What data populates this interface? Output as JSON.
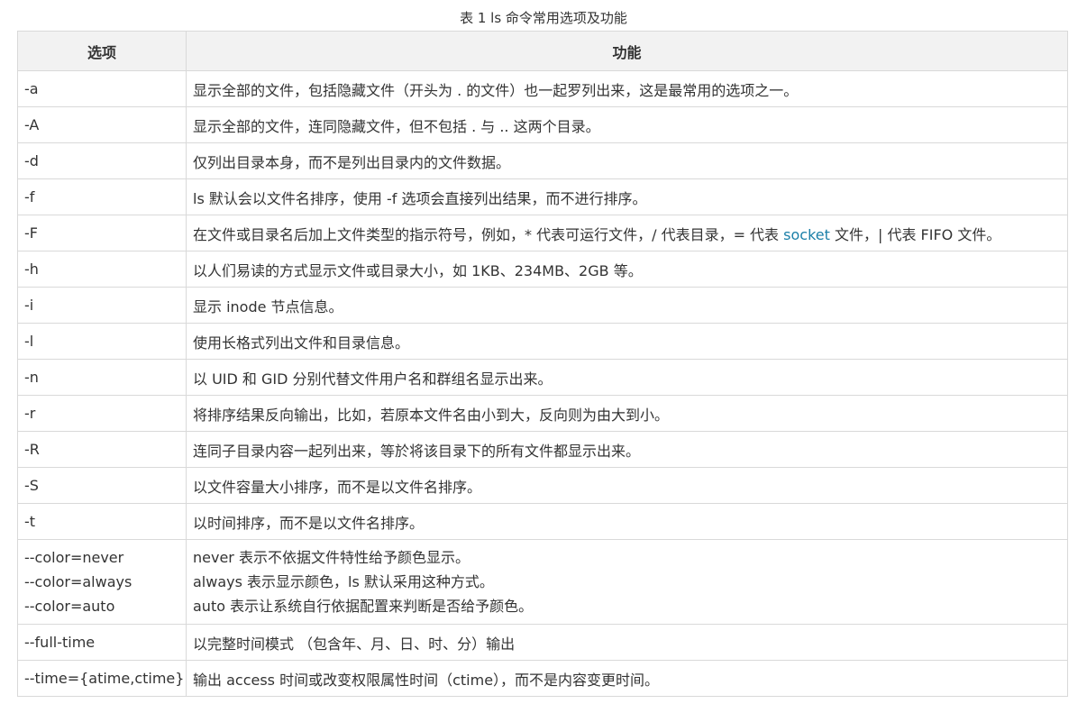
{
  "caption": "表 1 ls 命令常用选项及功能",
  "headers": {
    "option": "选项",
    "function": "功能"
  },
  "rows": [
    {
      "option": "-a",
      "desc": "显示全部的文件，包括隐藏文件（开头为 . 的文件）也一起罗列出来，这是最常用的选项之一。"
    },
    {
      "option": "-A",
      "desc": "显示全部的文件，连同隐藏文件，但不包括 . 与 .. 这两个目录。"
    },
    {
      "option": "-d",
      "desc": "仅列出目录本身，而不是列出目录内的文件数据。"
    },
    {
      "option": "-f",
      "desc": "ls 默认会以文件名排序，使用 -f 选项会直接列出结果，而不进行排序。"
    },
    {
      "option": "-F",
      "desc_pre": "在文件或目录名后加上文件类型的指示符号，例如，* 代表可运行文件，/ 代表目录，= 代表 ",
      "desc_link": "socket",
      "desc_post": " 文件，| 代表 FIFO 文件。"
    },
    {
      "option": "-h",
      "desc": "以人们易读的方式显示文件或目录大小，如 1KB、234MB、2GB 等。"
    },
    {
      "option": "-i",
      "desc": "显示 inode 节点信息。"
    },
    {
      "option": "-l",
      "desc": "使用长格式列出文件和目录信息。"
    },
    {
      "option": "-n",
      "desc": "以 UID 和 GID 分别代替文件用户名和群组名显示出来。"
    },
    {
      "option": "-r",
      "desc": "将排序结果反向输出，比如，若原本文件名由小到大，反向则为由大到小。"
    },
    {
      "option": "-R",
      "desc": "连同子目录内容一起列出来，等於将该目录下的所有文件都显示出来。"
    },
    {
      "option": "-S",
      "desc": "以文件容量大小排序，而不是以文件名排序。"
    },
    {
      "option": "-t",
      "desc": "以时间排序，而不是以文件名排序。"
    },
    {
      "options": [
        "--color=never",
        "--color=always",
        "--color=auto"
      ],
      "descs": [
        "never 表示不依据文件特性给予颜色显示。",
        "always 表示显示颜色，ls 默认采用这种方式。",
        "auto 表示让系统自行依据配置来判断是否给予颜色。"
      ]
    },
    {
      "option": "--full-time",
      "desc": "以完整时间模式 （包含年、月、日、时、分）输出"
    },
    {
      "option": "--time={atime,ctime}",
      "desc": "输出 access 时间或改变权限属性时间（ctime），而不是内容变更时间。"
    }
  ]
}
